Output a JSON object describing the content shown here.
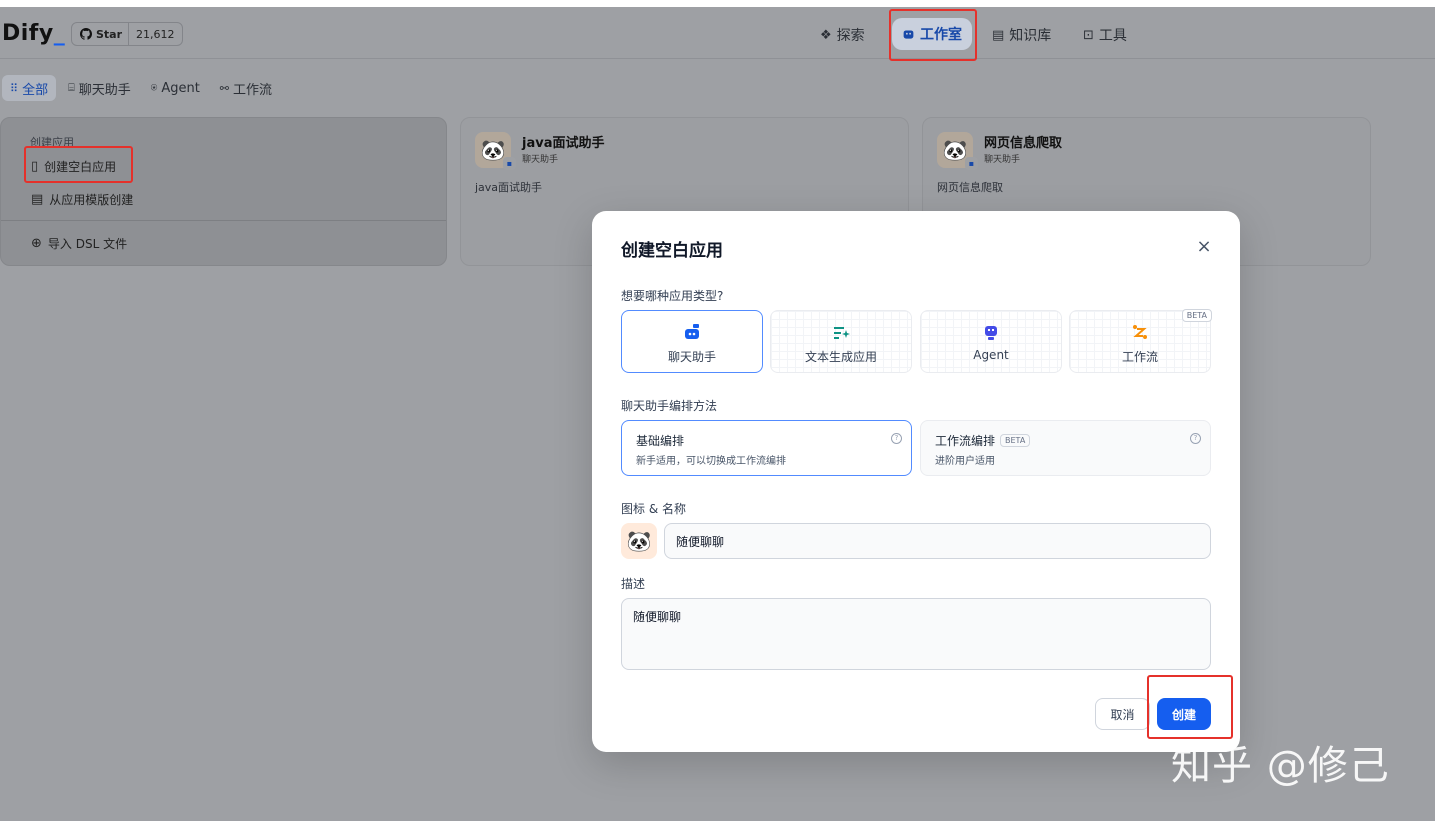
{
  "header": {
    "logo_text": "Dify",
    "logo_dot": "_",
    "github_star_label": "Star",
    "github_star_count": "21,612",
    "nav": [
      {
        "label": "探索",
        "icon": "compass-icon"
      },
      {
        "label": "工作室",
        "icon": "robot-icon",
        "active": true
      },
      {
        "label": "知识库",
        "icon": "book-icon"
      },
      {
        "label": "工具",
        "icon": "toolbox-icon"
      }
    ]
  },
  "filters": [
    {
      "label": "全部",
      "icon": "grid-icon",
      "active": true
    },
    {
      "label": "聊天助手",
      "icon": "chat-icon"
    },
    {
      "label": "Agent",
      "icon": "agent-icon"
    },
    {
      "label": "工作流",
      "icon": "workflow-icon"
    }
  ],
  "create_card": {
    "heading": "创建应用",
    "blank": "创建空白应用",
    "template": "从应用模版创建",
    "import_dsl": "导入 DSL 文件"
  },
  "apps": [
    {
      "name": "java面试助手",
      "type": "聊天助手",
      "description": "java面试助手"
    },
    {
      "name": "网页信息爬取",
      "type": "聊天助手",
      "description": "网页信息爬取"
    }
  ],
  "modal": {
    "title": "创建空白应用",
    "close": "×",
    "type_question": "想要哪种应用类型?",
    "types": [
      {
        "label": "聊天助手",
        "icon": "chat-bot-icon",
        "color": "#155eef"
      },
      {
        "label": "文本生成应用",
        "icon": "text-generation-icon",
        "color": "#0e9384"
      },
      {
        "label": "Agent",
        "icon": "agent-robot-icon",
        "color": "#444ce7"
      },
      {
        "label": "工作流",
        "icon": "workflow-icon",
        "color": "#f79009",
        "badge": "BETA"
      }
    ],
    "mode_label": "聊天助手编排方法",
    "modes": [
      {
        "title": "基础编排",
        "desc": "新手适用，可以切换成工作流编排"
      },
      {
        "title": "工作流编排",
        "badge": "BETA",
        "desc": "进阶用户适用"
      }
    ],
    "icon_name_label": "图标 & 名称",
    "name_value": "随便聊聊",
    "desc_label": "描述",
    "desc_value": "随便聊聊",
    "cancel": "取消",
    "create": "创建"
  },
  "watermark": "知乎 @修己",
  "colors": {
    "accent": "#155eef",
    "highlight_box": "#e5312b"
  }
}
